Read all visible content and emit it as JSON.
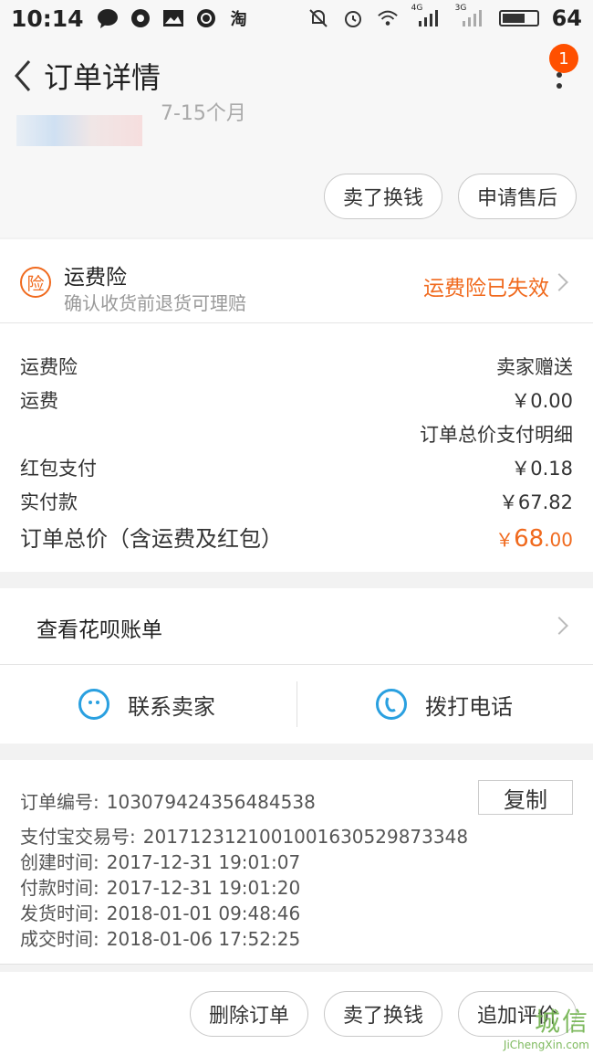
{
  "status_bar": {
    "time": "10:14",
    "carrier_app_icon": "淘",
    "network_4g": "4G",
    "network_3g": "3G",
    "battery_level": "64"
  },
  "nav": {
    "title": "订单详情",
    "badge_count": "1"
  },
  "product": {
    "spec_partial": "7-15个月"
  },
  "top_actions": {
    "sell_label": "卖了换钱",
    "after_sale_label": "申请售后"
  },
  "insurance": {
    "icon_char": "险",
    "title": "运费险",
    "subtitle": "确认收货前退货可理赔",
    "status": "运费险已失效"
  },
  "costs": {
    "shipping_insurance_label": "运费险",
    "shipping_insurance_value": "卖家赠送",
    "shipping_label": "运费",
    "shipping_value": "￥0.00",
    "detail_link": "订单总价支付明细",
    "red_packet_label": "红包支付",
    "red_packet_value": "￥0.18",
    "paid_label": "实付款",
    "paid_value": "￥67.82",
    "total_label": "订单总价（含运费及红包）",
    "total_currency": "￥",
    "total_int": "68",
    "total_dec": ".00"
  },
  "huabei": {
    "label": "查看花呗账单"
  },
  "contact": {
    "seller_label": "联系卖家",
    "call_label": "拨打电话"
  },
  "order_info": {
    "copy_label": "复制",
    "rows": [
      {
        "key": "订单编号:",
        "value": "103079424356484538"
      },
      {
        "key": "支付宝交易号:",
        "value": "2017123121001001630529873348"
      },
      {
        "key": "创建时间:",
        "value": "2017-12-31 19:01:07"
      },
      {
        "key": "付款时间:",
        "value": "2017-12-31 19:01:20"
      },
      {
        "key": "发货时间:",
        "value": "2018-01-01 09:48:46"
      },
      {
        "key": "成交时间:",
        "value": "2018-01-06 17:52:25"
      }
    ]
  },
  "bottom_actions": {
    "delete_label": "删除订单",
    "sell_label": "卖了换钱",
    "review_label": "追加评价"
  },
  "watermark": {
    "main": "城信",
    "url": "JiChengXin.com"
  },
  "colors": {
    "accent": "#f06a1e",
    "badge": "#ff5000",
    "contact_blue": "#2aa0e0"
  }
}
